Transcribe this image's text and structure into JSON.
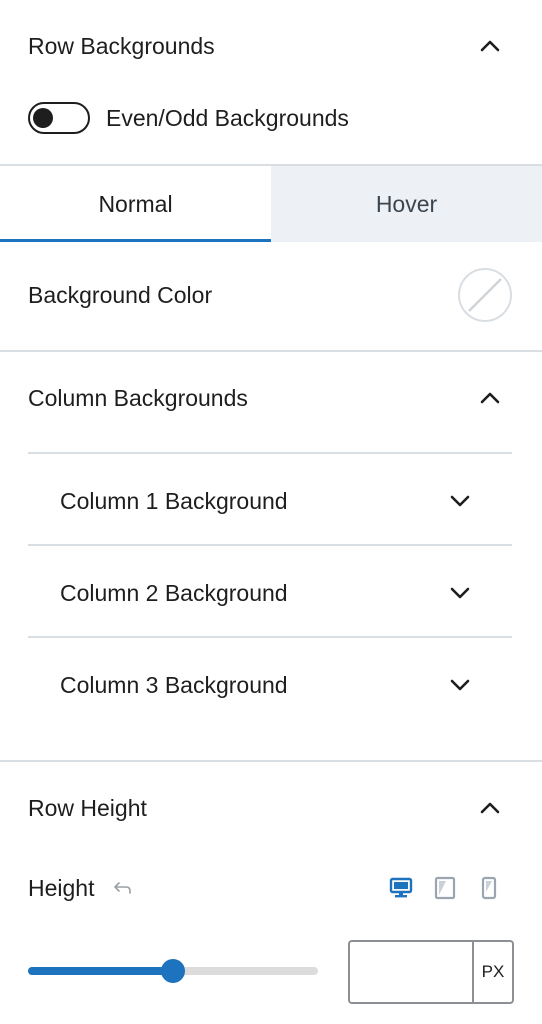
{
  "row_backgrounds": {
    "title": "Row Backgrounds",
    "toggle_label": "Even/Odd Backgrounds",
    "toggle_on": false
  },
  "tabs": [
    {
      "label": "Normal",
      "active": true
    },
    {
      "label": "Hover",
      "active": false
    }
  ],
  "background_color": {
    "label": "Background Color",
    "value": "none"
  },
  "column_backgrounds": {
    "title": "Column Backgrounds",
    "items": [
      {
        "label": "Column 1 Background"
      },
      {
        "label": "Column 2 Background"
      },
      {
        "label": "Column 3 Background"
      }
    ]
  },
  "row_height": {
    "title": "Row Height",
    "height_label": "Height",
    "devices": [
      "desktop-icon",
      "tablet-icon",
      "mobile-icon"
    ],
    "active_device": "desktop",
    "slider_fraction": 0.5,
    "input_value": "",
    "unit": "PX"
  },
  "colors": {
    "accent": "#1e73be",
    "divider": "#d9dee3",
    "inactive_tab_bg": "#edf1f5",
    "text": "#1e1e1e"
  }
}
